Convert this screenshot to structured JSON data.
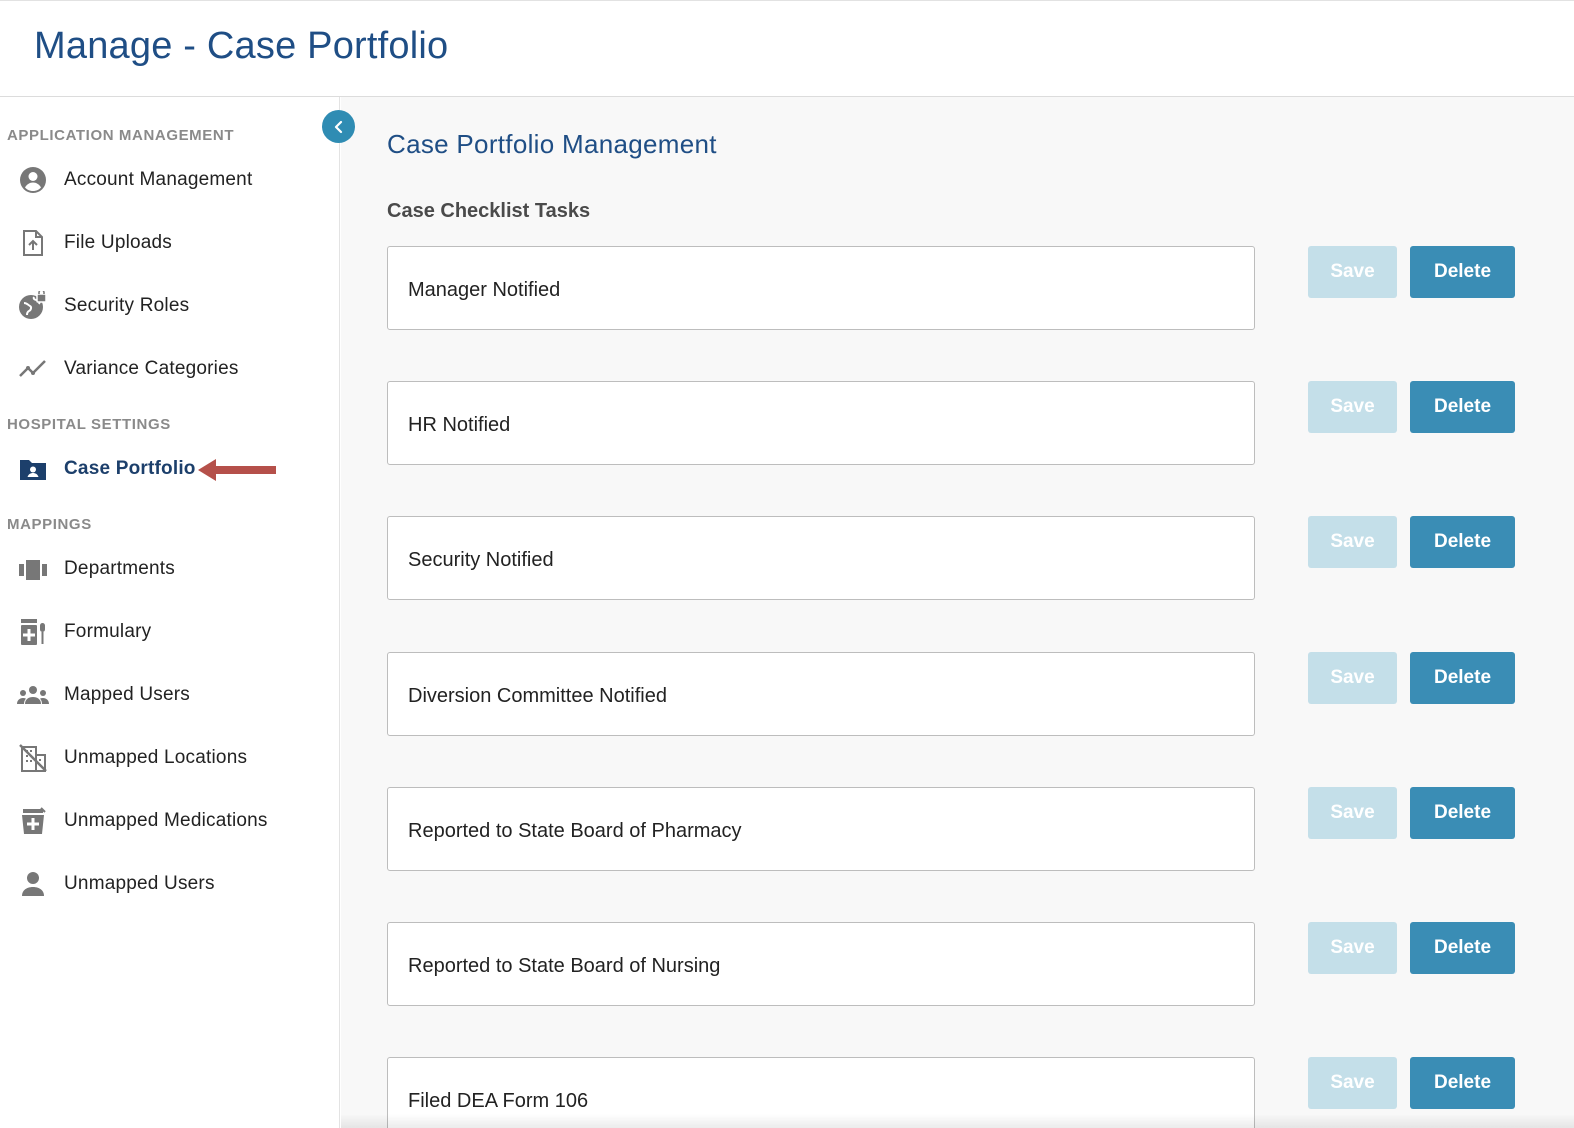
{
  "header": {
    "title": "Manage - Case Portfolio"
  },
  "sidebar": {
    "sections": [
      {
        "title": "APPLICATION MANAGEMENT"
      },
      {
        "title": "HOSPITAL SETTINGS"
      },
      {
        "title": "MAPPINGS"
      }
    ],
    "items": [
      {
        "label": "Account Management",
        "icon": "account-circle-icon"
      },
      {
        "label": "File Uploads",
        "icon": "file-upload-icon"
      },
      {
        "label": "Security Roles",
        "icon": "security-globe-icon"
      },
      {
        "label": "Variance Categories",
        "icon": "trend-line-icon"
      },
      {
        "label": "Case Portfolio",
        "icon": "folder-user-icon",
        "active": true
      },
      {
        "label": "Departments",
        "icon": "departments-icon"
      },
      {
        "label": "Formulary",
        "icon": "formulary-icon"
      },
      {
        "label": "Mapped Users",
        "icon": "group-users-icon"
      },
      {
        "label": "Unmapped Locations",
        "icon": "unmapped-building-icon"
      },
      {
        "label": "Unmapped Medications",
        "icon": "unmapped-medication-icon"
      },
      {
        "label": "Unmapped Users",
        "icon": "person-icon"
      }
    ],
    "collapse_icon": "chevron-left-icon"
  },
  "main": {
    "title": "Case Portfolio Management",
    "subtitle": "Case Checklist Tasks",
    "save_label": "Save",
    "delete_label": "Delete",
    "tasks": [
      {
        "value": "Manager Notified"
      },
      {
        "value": "HR Notified"
      },
      {
        "value": "Security Notified"
      },
      {
        "value": "Diversion Committee Notified"
      },
      {
        "value": "Reported to State Board of Pharmacy"
      },
      {
        "value": "Reported to State Board of Nursing"
      },
      {
        "value": "Filed DEA Form 106"
      }
    ]
  },
  "colors": {
    "title_blue": "#1f4e85",
    "active_nav": "#1c3f6b",
    "delete_button": "#3a8db5",
    "save_button_disabled": "#c4dfe9",
    "annotation_arrow": "#b5504a"
  }
}
